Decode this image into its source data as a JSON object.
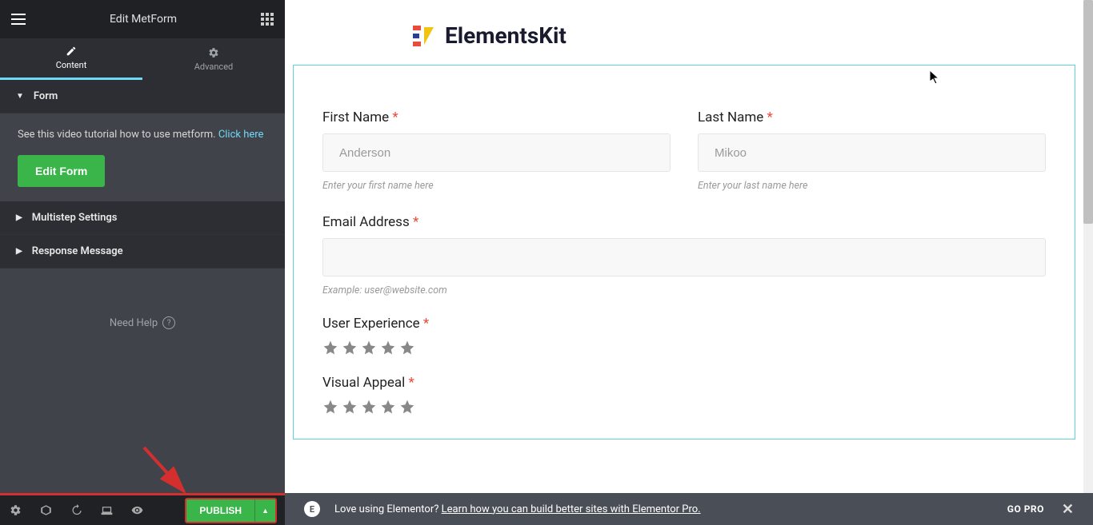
{
  "header": {
    "title": "Edit MetForm"
  },
  "tabs": {
    "content": "Content",
    "advanced": "Advanced"
  },
  "sections": {
    "form": "Form",
    "multistep": "Multistep Settings",
    "response": "Response Message"
  },
  "formPanel": {
    "tutorialText": "See this video tutorial how to use metform. ",
    "tutorialLink": "Click here",
    "editButton": "Edit Form"
  },
  "needHelp": "Need Help",
  "toolbar": {
    "publish": "PUBLISH"
  },
  "logo": {
    "text": "ElementsKit"
  },
  "form": {
    "firstName": {
      "label": "First Name ",
      "placeholder": "Anderson",
      "helper": "Enter your first name here"
    },
    "lastName": {
      "label": "Last Name ",
      "placeholder": "Mikoo",
      "helper": "Enter your last name here"
    },
    "email": {
      "label": "Email Address ",
      "helper": "Example: user@website.com"
    },
    "ux": {
      "label": "User Experience "
    },
    "visual": {
      "label": "Visual Appeal "
    },
    "required": "*"
  },
  "footer": {
    "text": "Love using Elementor? ",
    "link": "Learn how you can build better sites with Elementor Pro.",
    "goPro": "GO PRO"
  }
}
